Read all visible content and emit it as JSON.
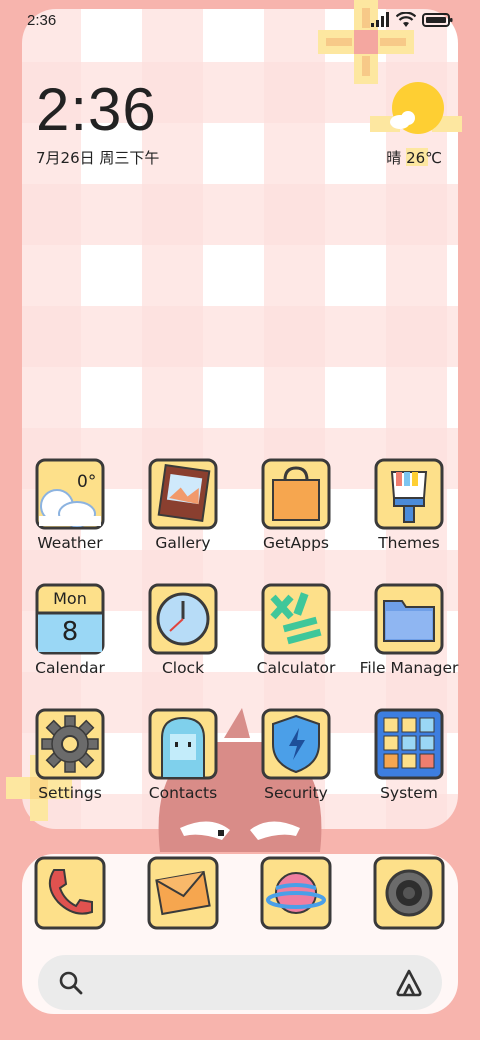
{
  "status_bar": {
    "time": "2:36"
  },
  "lockscreen": {
    "clock": "2:36",
    "date": "7月26日 周三下午",
    "weather": "晴 26℃"
  },
  "apps": [
    {
      "label": "Weather",
      "icon": "weather-icon",
      "badge": "0°"
    },
    {
      "label": "Gallery",
      "icon": "gallery-icon"
    },
    {
      "label": "GetApps",
      "icon": "getapps-icon"
    },
    {
      "label": "Themes",
      "icon": "themes-icon"
    },
    {
      "label": "Calendar",
      "icon": "calendar-icon",
      "weekday": "Mon",
      "day": "8"
    },
    {
      "label": "Clock",
      "icon": "clock-icon"
    },
    {
      "label": "Calculator",
      "icon": "calculator-icon"
    },
    {
      "label": "File Manager",
      "icon": "file-manager-icon"
    },
    {
      "label": "Settings",
      "icon": "gear-icon"
    },
    {
      "label": "Contacts",
      "icon": "contacts-icon"
    },
    {
      "label": "Security",
      "icon": "security-icon"
    },
    {
      "label": "System",
      "icon": "system-folder-icon"
    }
  ],
  "dock": [
    {
      "icon": "phone-icon"
    },
    {
      "icon": "messages-icon"
    },
    {
      "icon": "browser-icon"
    },
    {
      "icon": "camera-icon"
    }
  ],
  "colors": {
    "background": "#f7b4ad",
    "icon_fill": "#fde08a",
    "icon_border": "#3a3a3a",
    "checker": "#fde0de"
  }
}
